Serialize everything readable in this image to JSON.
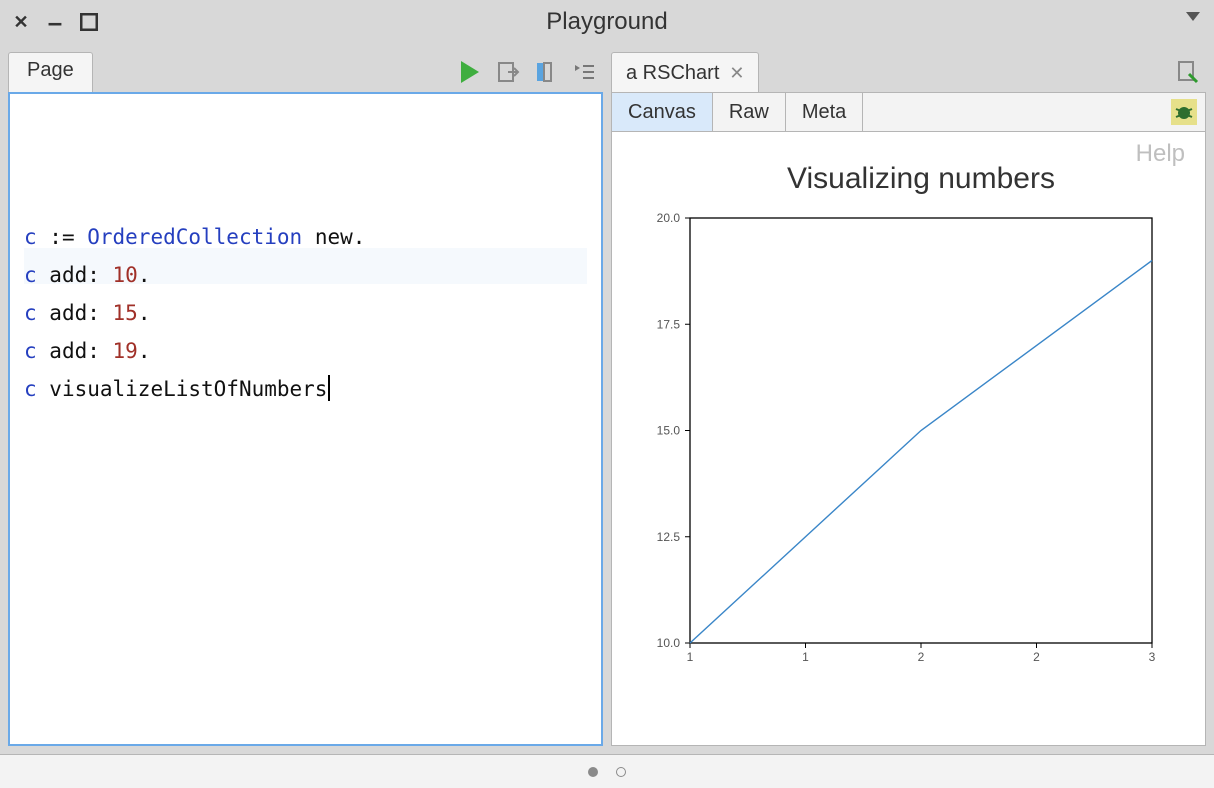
{
  "window": {
    "title": "Playground"
  },
  "left_pane": {
    "tab_label": "Page",
    "code_lines": [
      [
        {
          "cls": "tk-var",
          "t": "c"
        },
        {
          "cls": "",
          "t": " := "
        },
        {
          "cls": "tk-kw-class",
          "t": "OrderedCollection"
        },
        {
          "cls": "",
          "t": " new."
        }
      ],
      [
        {
          "cls": "tk-var",
          "t": "c"
        },
        {
          "cls": "",
          "t": " add: "
        },
        {
          "cls": "tk-num",
          "t": "10"
        },
        {
          "cls": "",
          "t": "."
        }
      ],
      [
        {
          "cls": "tk-var",
          "t": "c"
        },
        {
          "cls": "",
          "t": " add: "
        },
        {
          "cls": "tk-num",
          "t": "15"
        },
        {
          "cls": "",
          "t": "."
        }
      ],
      [
        {
          "cls": "tk-var",
          "t": "c"
        },
        {
          "cls": "",
          "t": " add: "
        },
        {
          "cls": "tk-num",
          "t": "19"
        },
        {
          "cls": "",
          "t": "."
        }
      ],
      [
        {
          "cls": "tk-var",
          "t": "c"
        },
        {
          "cls": "",
          "t": " visualizeListOfNumbers"
        }
      ]
    ],
    "cursor_line": 4
  },
  "right_pane": {
    "tab_label": "a RSChart",
    "subtabs": [
      "Canvas",
      "Raw",
      "Meta"
    ],
    "active_subtab": 0,
    "help_label": "Help"
  },
  "chart_data": {
    "type": "line",
    "title": "Visualizing numbers",
    "x": [
      1,
      2,
      3
    ],
    "values": [
      10,
      15,
      19
    ],
    "xlim": [
      1,
      3
    ],
    "ylim": [
      10,
      20
    ],
    "yticks": [
      10.0,
      12.5,
      15.0,
      17.5,
      20.0
    ],
    "xticks": [
      1,
      1,
      2,
      2,
      3
    ],
    "xlabel": "",
    "ylabel": ""
  }
}
